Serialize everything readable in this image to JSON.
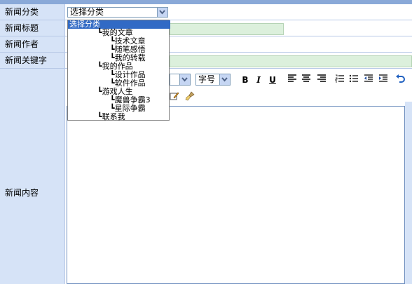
{
  "form": {
    "labels": {
      "category": "新闻分类",
      "title": "新闻标题",
      "author": "新闻作者",
      "keywords": "新闻关键字",
      "content": "新闻内容"
    },
    "category_select": {
      "value": "选择分类",
      "options": [
        {
          "text": "选择分类",
          "selected": true
        },
        {
          "text": "┗我的文章"
        },
        {
          "text": "┗技术文章"
        },
        {
          "text": "┗随笔感悟"
        },
        {
          "text": "┗我的转载"
        },
        {
          "text": "┗我的作品"
        },
        {
          "text": "┗设计作品"
        },
        {
          "text": "┗软件作品"
        },
        {
          "text": "┗游戏人生"
        },
        {
          "text": "┗魔兽争霸3"
        },
        {
          "text": "┗星际争霸"
        },
        {
          "text": "┗联系我"
        }
      ]
    }
  },
  "toolbar": {
    "font_size_select": "字号",
    "bold": "B",
    "italic": "I",
    "underline": "U"
  },
  "colors": {
    "page_bg": "#d6e3f7",
    "input_green": "#dcf0dc",
    "select_highlight": "#316ac5"
  }
}
